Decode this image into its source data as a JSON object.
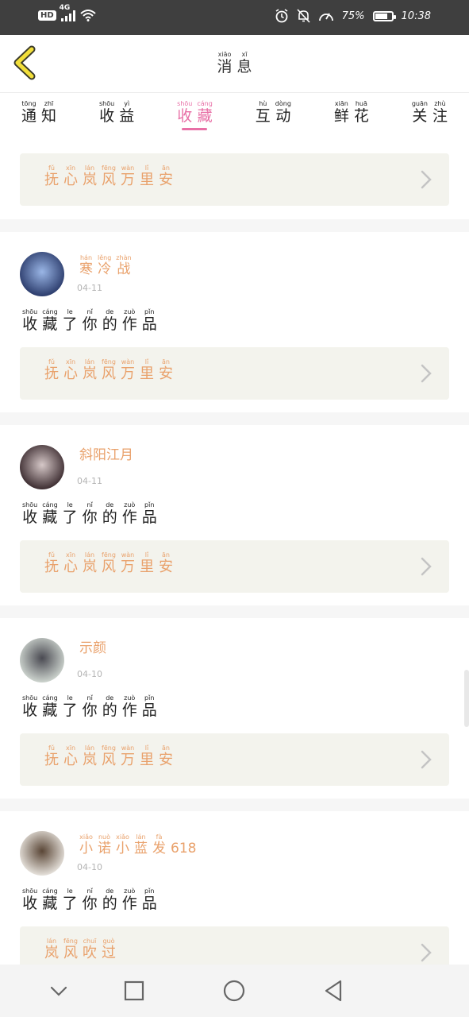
{
  "status_bar": {
    "hd": "HD",
    "network": "4G",
    "battery_text": "75%",
    "battery_level": 0.75,
    "time": "10:38"
  },
  "header": {
    "title_chars": [
      {
        "zh": "消",
        "py": "xiāo"
      },
      {
        "zh": "息",
        "py": "xī"
      }
    ]
  },
  "tabs": [
    {
      "chars": [
        {
          "zh": "通",
          "py": "tōng"
        },
        {
          "zh": "知",
          "py": "zhī"
        }
      ],
      "active": false
    },
    {
      "chars": [
        {
          "zh": "收",
          "py": "shōu"
        },
        {
          "zh": "益",
          "py": "yì"
        }
      ],
      "active": false
    },
    {
      "chars": [
        {
          "zh": "收",
          "py": "shōu"
        },
        {
          "zh": "藏",
          "py": "cáng"
        }
      ],
      "active": true
    },
    {
      "chars": [
        {
          "zh": "互",
          "py": "hù"
        },
        {
          "zh": "动",
          "py": "dòng"
        }
      ],
      "active": false
    },
    {
      "chars": [
        {
          "zh": "鲜",
          "py": "xiān"
        },
        {
          "zh": "花",
          "py": "huā"
        }
      ],
      "active": false
    },
    {
      "chars": [
        {
          "zh": "关",
          "py": "guān"
        },
        {
          "zh": "注",
          "py": "zhù"
        }
      ],
      "active": false
    }
  ],
  "top_work": {
    "chars": [
      {
        "zh": "抚",
        "py": "fǔ"
      },
      {
        "zh": "心",
        "py": "xīn"
      },
      {
        "zh": "岚",
        "py": "lán"
      },
      {
        "zh": "风",
        "py": "fēng"
      },
      {
        "zh": "万",
        "py": "wàn"
      },
      {
        "zh": "里",
        "py": "lǐ"
      },
      {
        "zh": "安",
        "py": "ān"
      }
    ]
  },
  "action_chars": [
    {
      "zh": "收",
      "py": "shōu"
    },
    {
      "zh": "藏",
      "py": "cáng"
    },
    {
      "zh": "了",
      "py": "le"
    },
    {
      "zh": "你",
      "py": "nǐ"
    },
    {
      "zh": "的",
      "py": "de"
    },
    {
      "zh": "作",
      "py": "zuò"
    },
    {
      "zh": "品",
      "py": "pǐn"
    }
  ],
  "items": [
    {
      "user_chars": [
        {
          "zh": "寒",
          "py": "hán"
        },
        {
          "zh": "冷",
          "py": "lěng"
        },
        {
          "zh": "战",
          "py": "zhàn"
        }
      ],
      "date": "04-11",
      "work_chars": [
        {
          "zh": "抚",
          "py": "fǔ"
        },
        {
          "zh": "心",
          "py": "xīn"
        },
        {
          "zh": "岚",
          "py": "lán"
        },
        {
          "zh": "风",
          "py": "fēng"
        },
        {
          "zh": "万",
          "py": "wàn"
        },
        {
          "zh": "里",
          "py": "lǐ"
        },
        {
          "zh": "安",
          "py": "ān"
        }
      ]
    },
    {
      "user_chars": [
        {
          "zh": "斜阳江月",
          "py": ""
        }
      ],
      "date": "04-11",
      "work_chars": [
        {
          "zh": "抚",
          "py": "fǔ"
        },
        {
          "zh": "心",
          "py": "xīn"
        },
        {
          "zh": "岚",
          "py": "lán"
        },
        {
          "zh": "风",
          "py": "fēng"
        },
        {
          "zh": "万",
          "py": "wàn"
        },
        {
          "zh": "里",
          "py": "lǐ"
        },
        {
          "zh": "安",
          "py": "ān"
        }
      ]
    },
    {
      "user_chars": [
        {
          "zh": "示颜",
          "py": ""
        }
      ],
      "date": "04-10",
      "work_chars": [
        {
          "zh": "抚",
          "py": "fǔ"
        },
        {
          "zh": "心",
          "py": "xīn"
        },
        {
          "zh": "岚",
          "py": "lán"
        },
        {
          "zh": "风",
          "py": "fēng"
        },
        {
          "zh": "万",
          "py": "wàn"
        },
        {
          "zh": "里",
          "py": "lǐ"
        },
        {
          "zh": "安",
          "py": "ān"
        }
      ]
    },
    {
      "user_chars": [
        {
          "zh": "小",
          "py": "xiǎo"
        },
        {
          "zh": "诺",
          "py": "nuò"
        },
        {
          "zh": "小",
          "py": "xiǎo"
        },
        {
          "zh": "蓝",
          "py": "lán"
        },
        {
          "zh": "发",
          "py": "fà"
        },
        {
          "zh": "618",
          "py": ""
        }
      ],
      "date": "04-10",
      "work_chars": [
        {
          "zh": "岚",
          "py": "lán"
        },
        {
          "zh": "风",
          "py": "fēng"
        },
        {
          "zh": "吹",
          "py": "chuī"
        },
        {
          "zh": "过",
          "py": "guò"
        }
      ]
    }
  ],
  "nav": {
    "icons": [
      "chevron-down-icon",
      "square-icon",
      "circle-icon",
      "triangle-back-icon"
    ]
  },
  "colors": {
    "accent": "#e86fa6",
    "work_text": "#e9a16b",
    "card_bg": "#f3f3ed"
  }
}
